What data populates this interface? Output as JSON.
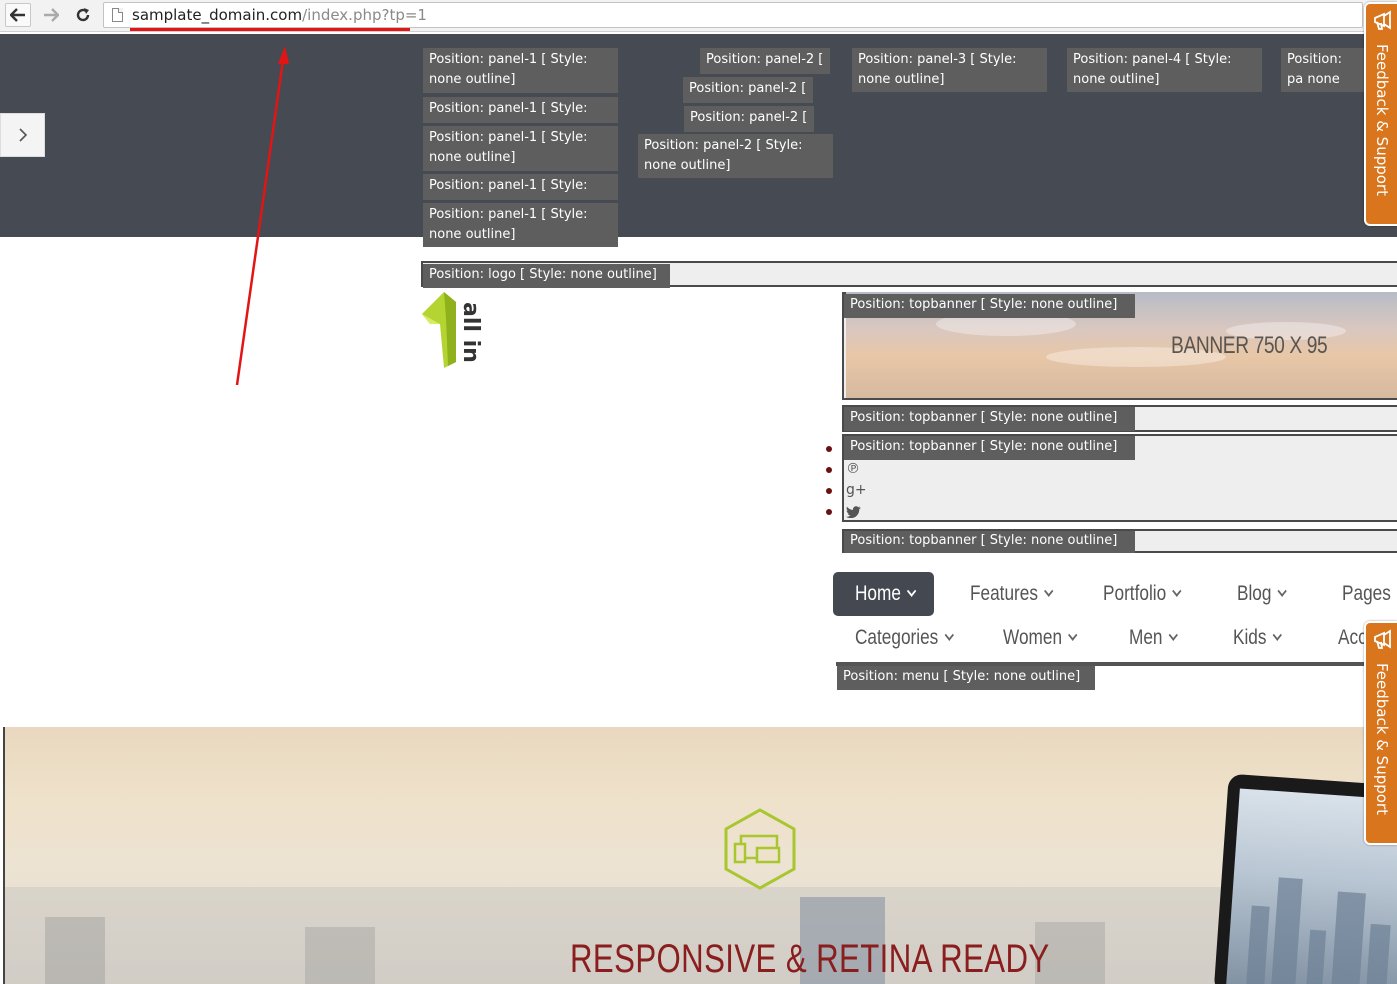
{
  "browser": {
    "url_domain": "samplate_domain.com",
    "url_path": "/index.php?tp=1"
  },
  "panels": {
    "panel1": [
      "Position: panel-1 [ Style: none outline]",
      "Position: panel-1 [ Style:",
      "Position: panel-1 [ Style: none outline]",
      "Position: panel-1 [ Style:",
      "Position: panel-1 [ Style: none outline]"
    ],
    "panel2": [
      "Position: panel-2 [",
      "Position: panel-2 [",
      "Position: panel-2 [",
      "Position: panel-2 [ Style: none outline]"
    ],
    "panel3": "Position: panel-3 [ Style: none outline]",
    "panel4": "Position: panel-4 [ Style: none outline]",
    "panel5": "Position: pa none outline"
  },
  "logo": {
    "position_label": "Position: logo [ Style: none outline]",
    "text": "all in"
  },
  "topbanner": {
    "label": "Position: topbanner [ Style: none outline]",
    "banner_text": "BANNER 750 X 95"
  },
  "social_icons": [
    "pinterest-icon",
    "google-plus-icon",
    "twitter-icon"
  ],
  "menu": {
    "row1": [
      "Home",
      "Features",
      "Portfolio",
      "Blog",
      "Pages"
    ],
    "row2": [
      "Categories",
      "Women",
      "Men",
      "Kids",
      "Acc"
    ],
    "position_label": "Position: menu [ Style: none outline]"
  },
  "feedback": {
    "label": "Feedback & Support"
  },
  "hero": {
    "title": "RESPONSIVE & RETINA READY"
  },
  "colors": {
    "dark_panel": "#464a52",
    "annotation_red": "#e31414",
    "feedback_orange": "#d9761d",
    "hero_title": "#8a1d1d",
    "icon_green": "#a8c62d"
  }
}
